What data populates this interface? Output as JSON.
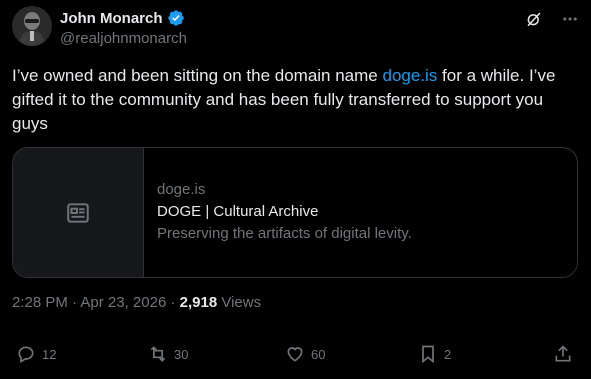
{
  "author": {
    "display_name": "John Monarch",
    "handle": "@realjohnmonarch"
  },
  "tweet": {
    "text_before": "I’ve owned and been sitting on the domain name ",
    "link_text": "doge.is",
    "text_after": " for a while. I’ve gifted it to the community and has been fully transferred to support you guys"
  },
  "card": {
    "domain": "doge.is",
    "title": "DOGE | Cultural Archive",
    "description": "Preserving the artifacts of digital levity."
  },
  "meta": {
    "time": "2:28 PM",
    "separator1": " · ",
    "date": "Apr 23, 2026",
    "separator2": " · ",
    "views_count": "2,918",
    "views_label": " Views"
  },
  "actions": {
    "replies": "12",
    "reposts": "30",
    "likes": "60",
    "bookmarks": "2"
  },
  "colors": {
    "background": "#000000",
    "text": "#e7e9ea",
    "muted": "#71767b",
    "link": "#1d9bf0",
    "border": "#2f3336"
  }
}
